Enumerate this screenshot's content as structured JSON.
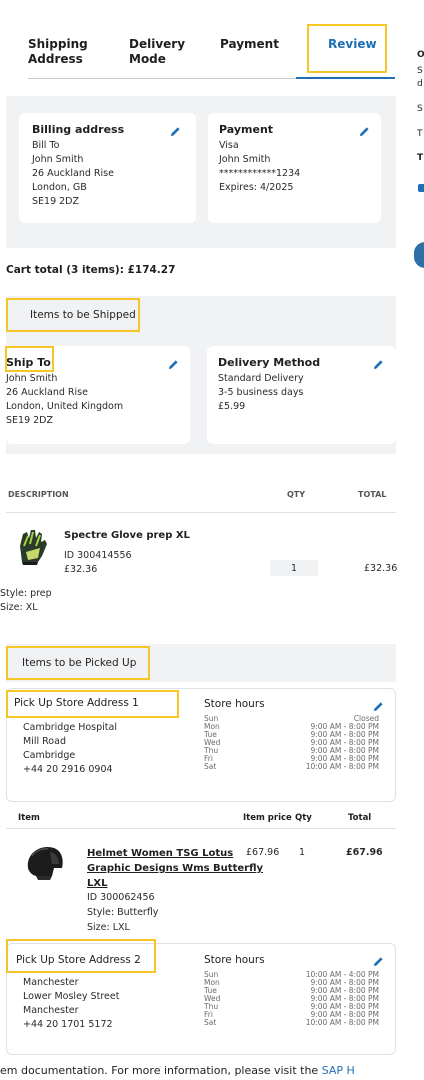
{
  "tabs": [
    {
      "label_line1": "Shipping",
      "label_line2": "Address"
    },
    {
      "label_line1": "Delivery",
      "label_line2": "Mode"
    },
    {
      "label_line1": "Payment",
      "label_line2": ""
    },
    {
      "label_line1": "Review",
      "label_line2": ""
    }
  ],
  "sidebar_fragments": [
    "O",
    "S",
    "d",
    "S",
    "T",
    "T"
  ],
  "billing": {
    "title": "Billing address",
    "lines": [
      "Bill To",
      "John Smith",
      "26 Auckland Rise",
      "London, GB",
      "SE19 2DZ"
    ]
  },
  "payment": {
    "title": "Payment",
    "lines": [
      "Visa",
      "John Smith",
      "************1234",
      "Expires: 4/2025"
    ]
  },
  "cart_total": "Cart total (3 items): £174.27",
  "shipped_section": {
    "heading": "Items to be Shipped",
    "ship_to_title": "Ship To",
    "ship_to_lines": [
      "John Smith",
      "26 Auckland Rise",
      "London, United Kingdom",
      "SE19 2DZ"
    ],
    "delivery_title": "Delivery Method",
    "delivery_lines": [
      "Standard Delivery",
      "3-5 business days",
      "£5.99"
    ]
  },
  "items_table": {
    "headers": {
      "description": "DESCRIPTION",
      "qty": "QTY",
      "total": "TOTAL"
    },
    "item": {
      "name": "Spectre Glove prep XL",
      "id": "ID 300414556",
      "price": "£32.36",
      "qty": "1",
      "total": "£32.36",
      "style": "Style: prep",
      "size": "Size: XL"
    }
  },
  "pickup_section": {
    "heading": "Items to be Picked Up",
    "store1": {
      "title": "Pick Up Store Address 1",
      "lines": [
        "Cambridge Hospital",
        "Mill Road",
        "Cambridge",
        "+44 20 2916 0904"
      ],
      "hours_title": "Store hours",
      "days": [
        "Sun",
        "Mon",
        "Tue",
        "Wed",
        "Thu",
        "Fri",
        "Sat"
      ],
      "hours": [
        "Closed",
        "9:00 AM - 8:00 PM",
        "9:00 AM - 8:00 PM",
        "9:00 AM - 8:00 PM",
        "9:00 AM - 8:00 PM",
        "9:00 AM - 8:00 PM",
        "10:00 AM - 8:00 PM"
      ]
    },
    "table_headers": {
      "item": "Item",
      "price": "Item price",
      "qty": "Qty",
      "total": "Total"
    },
    "item": {
      "name_line1": "Helmet Women TSG Lotus",
      "name_line2": "Graphic Designs Wms Butterfly",
      "name_line3": "LXL",
      "price": "£67.96",
      "qty": "1",
      "total": "£67.96",
      "id": "ID 300062456",
      "style": "Style: Butterfly",
      "size": "Size: LXL"
    },
    "store2": {
      "title": "Pick Up Store Address 2",
      "lines": [
        "Manchester",
        "Lower Mosley Street",
        "Manchester",
        "+44 20 1701 5172"
      ],
      "hours_title": "Store hours",
      "days": [
        "Sun",
        "Mon",
        "Tue",
        "Wed",
        "Thu",
        "Fri",
        "Sat"
      ],
      "hours": [
        "10:00 AM - 4:00 PM",
        "9:00 AM - 8:00 PM",
        "9:00 AM - 8:00 PM",
        "9:00 AM - 8:00 PM",
        "9:00 AM - 8:00 PM",
        "9:00 AM - 8:00 PM",
        "10:00 AM - 8:00 PM"
      ]
    }
  },
  "footer": {
    "text": "em documentation. For more information, please visit the ",
    "link": "SAP H"
  },
  "colors": {
    "highlight": "#f6c629",
    "accent": "#1f6fb5",
    "section_bg": "#f1f2f4"
  }
}
